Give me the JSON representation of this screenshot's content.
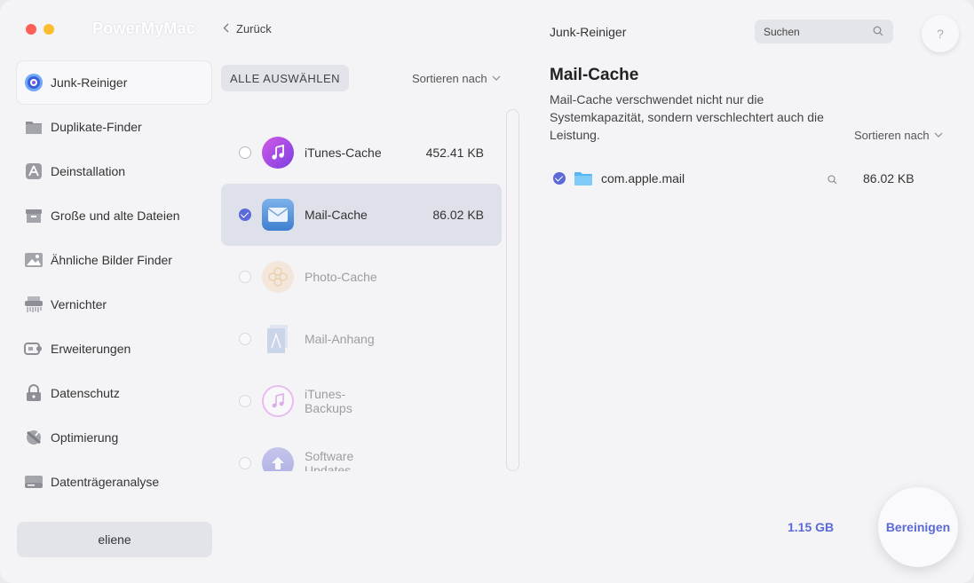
{
  "app": {
    "title": "PowerMyMac"
  },
  "sidebar": {
    "items": [
      {
        "label": "Junk-Reiniger",
        "icon": "junk-cleaner-icon"
      },
      {
        "label": "Duplikate-Finder",
        "icon": "folder-icon"
      },
      {
        "label": "Deinstallation",
        "icon": "app-uninstall-icon"
      },
      {
        "label": "Große und alte Dateien",
        "icon": "box-icon"
      },
      {
        "label": "Ähnliche Bilder Finder",
        "icon": "image-icon"
      },
      {
        "label": "Vernichter",
        "icon": "shredder-icon"
      },
      {
        "label": "Erweiterungen",
        "icon": "extension-icon"
      },
      {
        "label": "Datenschutz",
        "icon": "lock-icon"
      },
      {
        "label": "Optimierung",
        "icon": "optimize-icon"
      },
      {
        "label": "Datenträgeranalyse",
        "icon": "disk-icon"
      }
    ],
    "user": "eliene"
  },
  "middle": {
    "back": "Zurück",
    "select_all": "ALLE AUSWÄHLEN",
    "sort": "Sortieren nach",
    "categories": [
      {
        "name": "iTunes-Cache",
        "size": "452.41 KB",
        "checked": false,
        "icon": "music-note-icon"
      },
      {
        "name": "Mail-Cache",
        "size": "86.02 KB",
        "checked": true,
        "icon": "mail-envelope-icon"
      },
      {
        "name": "Photo-Cache",
        "size": "",
        "checked": false,
        "icon": "photos-flower-icon"
      },
      {
        "name": "Mail-Anhang",
        "size": "",
        "checked": false,
        "icon": "attachment-icon"
      },
      {
        "name": "iTunes-\nBackups",
        "size": "",
        "checked": false,
        "icon": "music-backup-icon"
      },
      {
        "name": "Software\nUpdates",
        "size": "",
        "checked": false,
        "icon": "software-update-icon"
      }
    ]
  },
  "right": {
    "panel_title": "Junk-Reiniger",
    "search_placeholder": "Suchen",
    "help": "?",
    "heading": "Mail-Cache",
    "description": "Mail-Cache verschwendet nicht nur die Systemkapazität, sondern verschlechtert auch die Leistung.",
    "sort": "Sortieren nach",
    "files": [
      {
        "name": "com.apple.mail",
        "size": "86.02 KB",
        "checked": true
      }
    ],
    "total": "1.15 GB",
    "clean": "Bereinigen"
  },
  "colors": {
    "accent": "#5b6ad8",
    "background": "#f4f4f7",
    "selected_row": "#dfe1ea"
  }
}
